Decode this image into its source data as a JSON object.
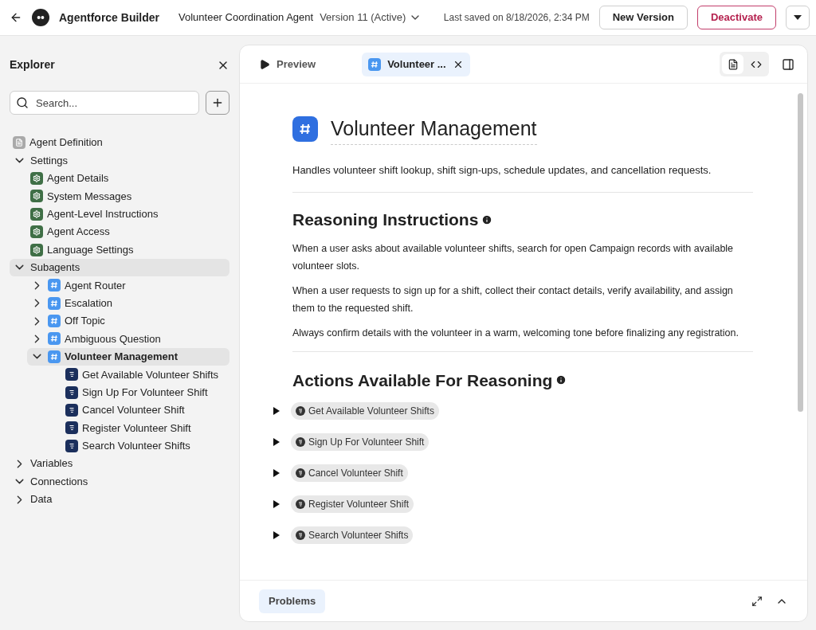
{
  "header": {
    "title": "Agentforce Builder",
    "agent_name": "Volunteer Coordination Agent",
    "version": "Version 11 (Active)",
    "last_saved": "Last saved on 8/18/2026, 2:34 PM",
    "buttons": [
      {
        "label": "New Version",
        "kind": "outline"
      },
      {
        "label": "Deactivate",
        "kind": "danger"
      }
    ]
  },
  "explorer": {
    "title": "Explorer",
    "search": {
      "placeholder": "Search..."
    },
    "tree": [
      {
        "label": "Agent Definition",
        "kind": "document",
        "selected": false
      },
      {
        "label": "Settings",
        "kind": "group",
        "expanded": true,
        "selected": false,
        "children": [
          {
            "label": "Agent Details",
            "kind": "setting",
            "selected": false
          },
          {
            "label": "System Messages",
            "kind": "setting",
            "selected": false
          },
          {
            "label": "Agent-Level Instructions",
            "kind": "setting",
            "selected": false
          },
          {
            "label": "Agent Access",
            "kind": "setting",
            "selected": false
          },
          {
            "label": "Language Settings",
            "kind": "setting",
            "selected": false
          }
        ]
      },
      {
        "label": "Subagents",
        "kind": "group",
        "expanded": true,
        "selected": true,
        "children": [
          {
            "label": "Agent Router",
            "kind": "subagent",
            "expanded": false,
            "selected": false
          },
          {
            "label": "Escalation",
            "kind": "subagent",
            "expanded": false,
            "selected": false
          },
          {
            "label": "Off Topic",
            "kind": "subagent",
            "expanded": false,
            "selected": false
          },
          {
            "label": "Ambiguous Question",
            "kind": "subagent",
            "expanded": false,
            "selected": false
          },
          {
            "label": "Volunteer Management",
            "kind": "subagent",
            "expanded": true,
            "selected": true,
            "children": [
              {
                "label": "Get Available Volunteer Shifts",
                "kind": "action",
                "selected": false
              },
              {
                "label": "Sign Up For Volunteer Shift",
                "kind": "action",
                "selected": false
              },
              {
                "label": "Cancel Volunteer Shift",
                "kind": "action",
                "selected": false
              },
              {
                "label": "Register Volunteer Shift",
                "kind": "action",
                "selected": false
              },
              {
                "label": "Search Volunteer Shifts",
                "kind": "action",
                "selected": false
              }
            ]
          }
        ]
      },
      {
        "label": "Variables",
        "kind": "group",
        "expanded": false,
        "selected": false
      },
      {
        "label": "Connections",
        "kind": "group",
        "expanded": true,
        "selected": false
      },
      {
        "label": "Data",
        "kind": "group",
        "expanded": false,
        "selected": false
      }
    ]
  },
  "editor": {
    "tabs": [
      {
        "label": "Preview",
        "kind": "preview",
        "selected": false
      },
      {
        "label": "Volunteer ...",
        "kind": "subagent",
        "selected": true
      }
    ],
    "view_modes": [
      {
        "kind": "document",
        "selected": true
      },
      {
        "kind": "code",
        "selected": false
      }
    ],
    "title": "Volunteer Management",
    "description": "Handles volunteer shift lookup, shift sign-ups, schedule updates, and cancellation requests.",
    "reasoning": {
      "heading": "Reasoning Instructions",
      "paragraphs": [
        "When a user asks about available volunteer shifts, search for open Campaign records with available volunteer slots.",
        "When a user requests to sign up for a shift, collect their contact details, verify availability, and assign them to the requested shift.",
        "Always confirm details with the volunteer in a warm, welcoming tone before finalizing any registration."
      ]
    },
    "actions": {
      "heading": "Actions Available For Reasoning",
      "items": [
        {
          "label": "Get Available Volunteer Shifts",
          "expanded": false
        },
        {
          "label": "Sign Up For Volunteer Shift",
          "expanded": false
        },
        {
          "label": "Cancel Volunteer Shift",
          "expanded": false
        },
        {
          "label": "Register Volunteer Shift",
          "expanded": false
        },
        {
          "label": "Search Volunteer Shifts",
          "expanded": false
        }
      ]
    },
    "bottom": {
      "label": "Problems"
    }
  }
}
